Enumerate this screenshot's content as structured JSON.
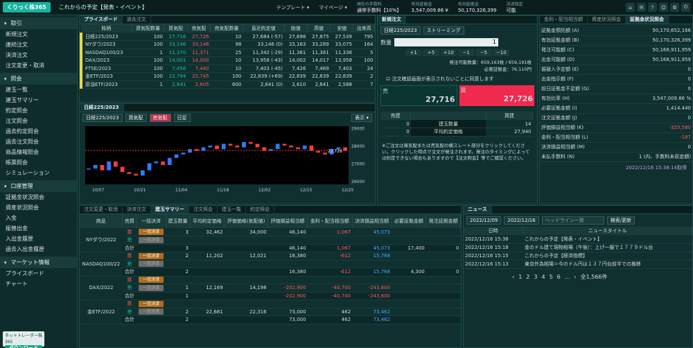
{
  "header": {
    "logo": "くりっく株365",
    "ticker": "これからの予定【発表・イベント】",
    "template": "テンプレート ▾",
    "mypage": "マイページ ▾",
    "stats": [
      {
        "k": "現在の手数料",
        "v": "通常手数料【10%】"
      },
      {
        "k": "有効証拠金",
        "v": "3,547,009.86 ¥"
      },
      {
        "k": "有効証拠金",
        "v": "50,170,326,399"
      },
      {
        "k": "決済指定",
        "v": "可能"
      }
    ]
  },
  "sidebar": {
    "sections": [
      {
        "title": "取引",
        "items": [
          "新規注文",
          "連続注文",
          "決済注文",
          "注文変更・取消"
        ]
      },
      {
        "title": "照会",
        "items": [
          "建玉一覧",
          "建玉サマリー",
          "約定照会",
          "注文照会",
          "過去約定照会",
          "過去注文照会",
          "商品情報照会",
          "帳票照会",
          "シミュレーション"
        ]
      },
      {
        "title": "口座管理",
        "items": [
          "証拠金状況照会",
          "資産状況照会",
          "入金",
          "振替出金",
          "入出金履歴",
          "過去入出金履歴"
        ]
      },
      {
        "title": "マーケット情報",
        "items": [
          "プライスボード",
          "チャート"
        ]
      }
    ],
    "download_title": "ネットトレーダー株365",
    "download_btn": "ダウンロード"
  },
  "board": {
    "tabs": [
      "プライスボード",
      "過去注文"
    ],
    "headers": [
      "銘柄",
      "買気配数量",
      "買気配",
      "売気配",
      "売気配数量",
      "直近約定値",
      "始値",
      "高値",
      "安値",
      "出来高"
    ],
    "rows": [
      [
        "日経225/2023",
        "100",
        "27,716",
        "27,726",
        "10",
        "27,684 (-57)",
        "27,698",
        "27,875",
        "27,539",
        "795"
      ],
      [
        "NYダウ/2023",
        "100",
        "33,146",
        "33,146",
        "98",
        "33,146 (0)",
        "33,163",
        "33,289",
        "33,075",
        "164"
      ],
      [
        "NASDAQ100/23",
        "1",
        "11,370",
        "11,371",
        "25",
        "11,342 (-29)",
        "11,381",
        "11,381",
        "11,338",
        "5"
      ],
      [
        "DAX/2023",
        "100",
        "14,001",
        "14,000",
        "10",
        "13,958 (-43)",
        "14,002",
        "14,017",
        "13,958",
        "100"
      ],
      [
        "FTSE/2023",
        "100",
        "7,456",
        "7,440",
        "10",
        "7,403 (-45)",
        "7,426",
        "7,469",
        "7,403",
        "24"
      ],
      [
        "金ETF/2023",
        "100",
        "22,794",
        "22,745",
        "100",
        "22,839 (+69)",
        "22,839",
        "22,839",
        "22,839",
        "2"
      ],
      [
        "原油ETF/2023",
        "1",
        "2,641",
        "2,605",
        "600",
        "2,641 (0)",
        "2,610",
        "2,641",
        "2,588",
        "7"
      ]
    ]
  },
  "chart": {
    "tab": "日経225/2023",
    "symbol": "日経225/2023",
    "buy": "買気配",
    "sell": "売気配",
    "period": "日足",
    "display": "表示 ▾",
    "yticks": [
      "29000",
      "28000",
      "27000",
      "26000"
    ],
    "xticks": [
      "10/07",
      "10/21",
      "11/04",
      "11/18",
      "12/02",
      "12/15",
      "12/25"
    ],
    "price_tag": "27,726"
  },
  "chart_data": {
    "type": "candlestick",
    "ylim": [
      25800,
      29100
    ],
    "values": [
      26700,
      26900,
      26600,
      27100,
      26800,
      26500,
      26400,
      26300,
      26600,
      27000,
      27100,
      26900,
      27300,
      27500,
      27600,
      27800,
      27700,
      27900,
      28000,
      27800,
      28100,
      28000,
      27900,
      28200,
      28100,
      27900,
      27700,
      27800,
      28100,
      28000,
      27900,
      27800,
      28000,
      27700,
      27600,
      27500,
      27800,
      27900,
      27700
    ]
  },
  "order": {
    "tab": "新規注文",
    "symbol": "日経225/2023",
    "mode": "ストリーミング",
    "qty_label": "数量",
    "qty": "1",
    "steps": [
      "+1",
      "+5",
      "+10",
      "−1",
      "−5",
      "−10"
    ],
    "pending_label": "発注可能数量：",
    "pending": "659,163枚",
    "pending2": "659,191枚",
    "margin_label": "必要証拠金：",
    "margin": "76,110円",
    "confirm": "注文確認画面が表示されないことに同意します",
    "sell": "売",
    "sell_price": "27,716",
    "buy": "買",
    "buy_price": "27,726",
    "pos_headers": [
      "売建",
      "",
      "買建"
    ],
    "pos_rows": [
      [
        "0",
        "建玉数量",
        "14"
      ],
      [
        "0",
        "平均約定価格",
        "27,940"
      ]
    ],
    "note": "※ご注文は買気配または売気配の横スレート部分をクリックしてください。クリックした時点で注文が発注されます。発注のタイミングによっては約定できない場合もありますので【注文照会】等でご確認ください。"
  },
  "margin": {
    "tabs": [
      "金利・配当相当額",
      "資産状況照会",
      "証拠金状況照会"
    ],
    "rows": [
      [
        "証拠金預託額 (A)",
        "50,170,652,166"
      ],
      [
        "有効証拠金額 (B)",
        "50,170,326,399"
      ],
      [
        "発注可能額 (C)",
        "50,168,911,959"
      ],
      [
        "出金可能額 (D)",
        "50,168,911,959"
      ],
      [
        "振替入予定額 (E)",
        "0"
      ],
      [
        "出金指示額 (F)",
        "0"
      ],
      [
        "前日証拠金不足額 (G)",
        "0"
      ],
      [
        "有効比率 (H)",
        "3,547,009.86 %"
      ],
      [
        "必要証拠金額 (I)",
        "1,414.440"
      ],
      [
        "注文証拠金額 (J)",
        "0"
      ],
      [
        "評価損益相当額 (K)",
        "-325,580"
      ],
      [
        "金利・配当相当額 (L)",
        "-187"
      ],
      [
        "決済損益相当額 (M)",
        "0"
      ],
      [
        "未払手数料 (N)",
        "1 (内、手数料未収金額)"
      ]
    ],
    "timestamp": "2022/12/16 15:38:14取得"
  },
  "summary": {
    "tabs": [
      "注文変更・取消",
      "決済注文",
      "建玉サマリー",
      "注文照会",
      "建玉一覧",
      "約定照会"
    ],
    "headers": [
      "商品",
      "売買",
      "一括決済",
      "建玉数量",
      "平均約定価格",
      "評価価格(気配値)",
      "評価損益相当額",
      "金利・配当相当額",
      "決済損益相当額",
      "必要証拠金額",
      "発注証拠金額"
    ],
    "groups": [
      {
        "name": "NYダウ/2022",
        "rows": [
          [
            "買",
            "一括決済",
            "3",
            "32,462",
            "34,000",
            "46,140",
            "-1,067",
            "45,073",
            "",
            ""
          ],
          [
            "売",
            "一括決済",
            "",
            "",
            "",
            "",
            "",
            "",
            "",
            ""
          ],
          [
            "合計",
            "",
            "3",
            "",
            "",
            "46,140",
            "-1,067",
            "45,073",
            "17,400",
            "0"
          ]
        ]
      },
      {
        "name": "NASDAQ100/22",
        "rows": [
          [
            "買",
            "一括決済",
            "2",
            "11,202",
            "12,021",
            "16,380",
            "-612",
            "15,768",
            "",
            ""
          ],
          [
            "売",
            "一括決済",
            "",
            "",
            "",
            "",
            "",
            "",
            "",
            ""
          ],
          [
            "合計",
            "",
            "2",
            "",
            "",
            "16,380",
            "-612",
            "15,768",
            "4,300",
            "0"
          ]
        ]
      },
      {
        "name": "DAX/2022",
        "rows": [
          [
            "買",
            "一括決済",
            "",
            "",
            "",
            "",
            "",
            "",
            "",
            ""
          ],
          [
            "売",
            "一括決済",
            "1",
            "12,169",
            "14,198",
            "-202,900",
            "-40,700",
            "-243,600",
            "",
            ""
          ],
          [
            "合計",
            "",
            "1",
            "",
            "",
            "-202,900",
            "-40,700",
            "-243,600",
            "",
            ""
          ]
        ]
      },
      {
        "name": "金ETF/2022",
        "rows": [
          [
            "買",
            "一括決済",
            "",
            "",
            "",
            "",
            "",
            "",
            "",
            ""
          ],
          [
            "売",
            "一括決済",
            "2",
            "22,681",
            "22,316",
            "73,000",
            "462",
            "73,462",
            "",
            ""
          ],
          [
            "合計",
            "",
            "2",
            "",
            "",
            "73,000",
            "462",
            "73,462",
            "",
            ""
          ]
        ]
      }
    ]
  },
  "news": {
    "tab": "ニュース",
    "from": "2022/12/09",
    "to": "2022/12/16",
    "placeholder": "ヘッドライン一致",
    "search": "検索/更新",
    "headers": [
      "日時",
      "ニュースタイトル"
    ],
    "rows": [
      [
        "2022/12/16 15:38",
        "これからの予定【発表・イベント】"
      ],
      [
        "2022/12/16 15:18",
        "金のドル建て現物相場（午後）：上げ一服で１７７９ドル台"
      ],
      [
        "2022/12/16 15:15",
        "これからの予定【経済指標】"
      ],
      [
        "2022/12/16 15:13",
        "東京外為相場＝今のドル円は１３７円台前半での推移"
      ]
    ],
    "pages": [
      "1",
      "2",
      "3",
      "4",
      "5",
      "6",
      "..."
    ],
    "total": "全1,566件"
  }
}
